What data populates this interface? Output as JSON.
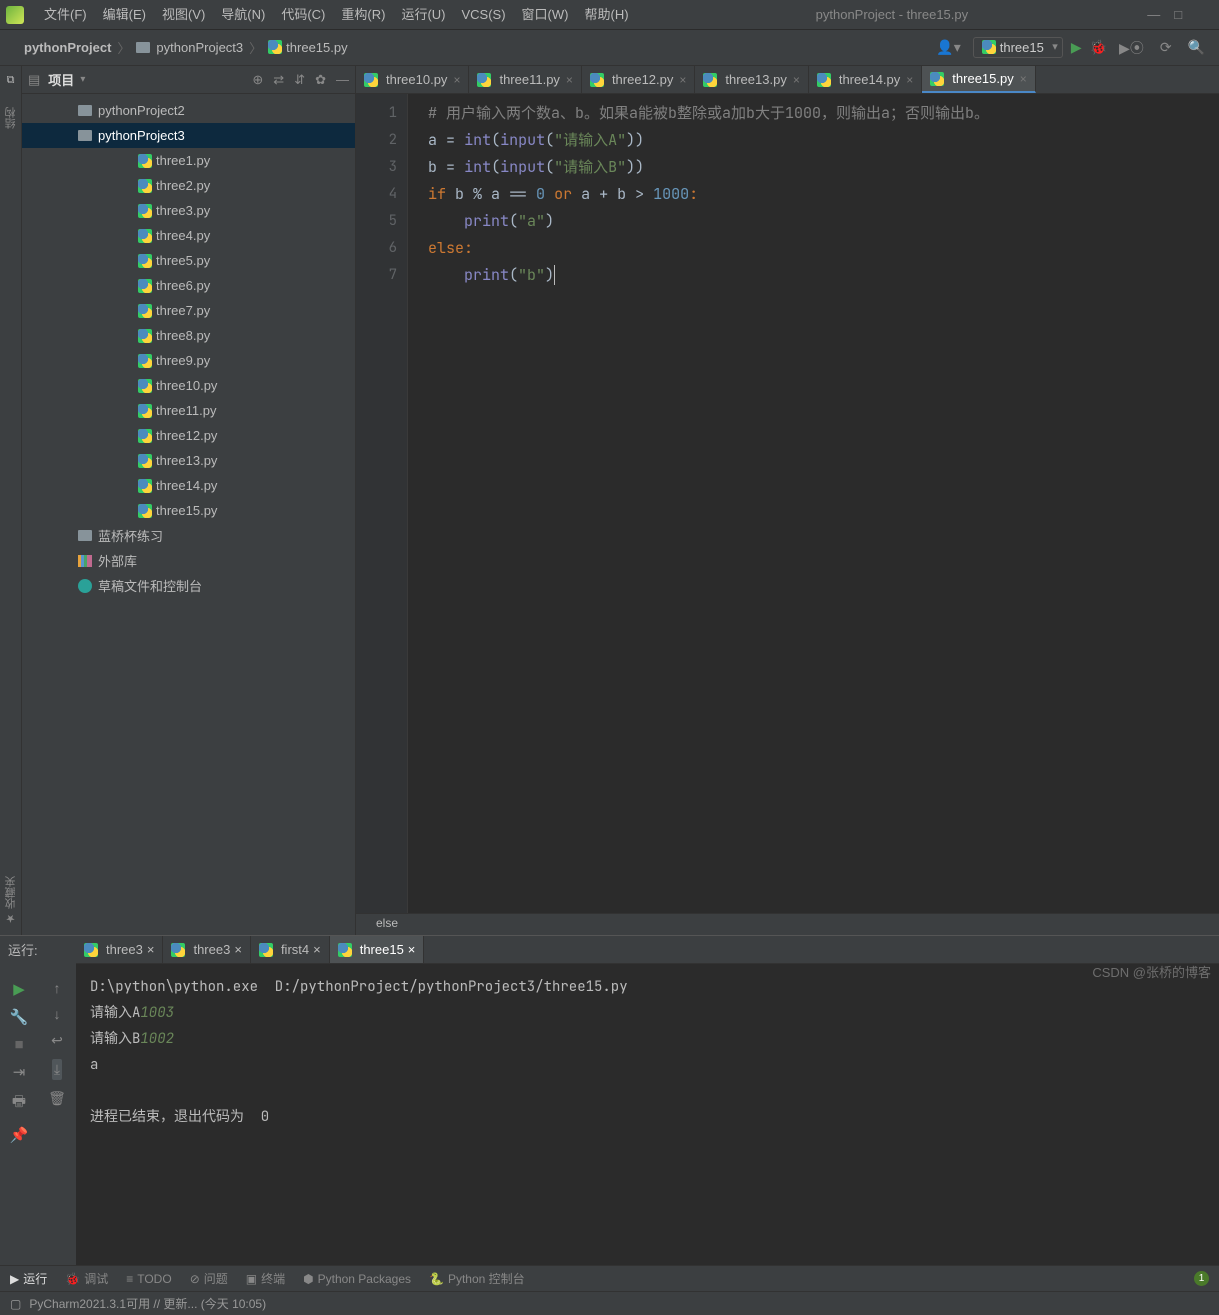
{
  "menubar": {
    "items": [
      "文件(F)",
      "编辑(E)",
      "视图(V)",
      "导航(N)",
      "代码(C)",
      "重构(R)",
      "运行(U)",
      "VCS(S)",
      "窗口(W)",
      "帮助(H)"
    ]
  },
  "window_title": "pythonProject - three15.py",
  "breadcrumbs": {
    "project": "pythonProject",
    "folder": "pythonProject3",
    "file": "three15.py"
  },
  "run_config_selected": "three15",
  "sidebar": {
    "title": "项目",
    "roots": [
      {
        "type": "folder",
        "label": "pythonProject2",
        "expanded": false,
        "indent": 0
      },
      {
        "type": "folder",
        "label": "pythonProject3",
        "expanded": true,
        "indent": 0,
        "selected": true,
        "children": [
          "three1.py",
          "three2.py",
          "three3.py",
          "three4.py",
          "three5.py",
          "three6.py",
          "three7.py",
          "three8.py",
          "three9.py",
          "three10.py",
          "three11.py",
          "three12.py",
          "three13.py",
          "three14.py",
          "three15.py"
        ]
      },
      {
        "type": "folder",
        "label": "蓝桥杯练习",
        "expanded": false,
        "indent": 0
      },
      {
        "type": "lib",
        "label": "外部库",
        "expanded": false,
        "indent": 0
      },
      {
        "type": "scratch",
        "label": "草稿文件和控制台",
        "indent": 0
      }
    ]
  },
  "left_gutter": [
    "结构",
    "收藏夹"
  ],
  "editor_tabs": [
    "three10.py",
    "three11.py",
    "three12.py",
    "three13.py",
    "three14.py",
    "three15.py"
  ],
  "editor_active_tab": "three15.py",
  "code_lines": 7,
  "code": {
    "comment": "# 用户输入两个数a、b。如果a能被b整除或a加b大于1000，则输出a；否则输出b。",
    "l2": {
      "a": "a",
      "eq": "=",
      "fn": "int",
      "fn2": "input",
      "str": "\"请输入A\""
    },
    "l3": {
      "a": "b",
      "eq": "=",
      "fn": "int",
      "fn2": "input",
      "str": "\"请输入B\""
    },
    "l4": {
      "kw": "if",
      "cond": " b % a == ",
      "zero": "0",
      "or": "or",
      "cond2": " a + b > ",
      "thou": "1000",
      "colon": ":"
    },
    "l5": {
      "fn": "print",
      "str": "\"a\""
    },
    "l6": {
      "kw": "else",
      "colon": ":"
    },
    "l7": {
      "fn": "print",
      "str": "\"b\""
    }
  },
  "crumb_trail": "else",
  "run_tabs_label": "运行:",
  "run_tabs": [
    "three3",
    "three3",
    "first4",
    "three15"
  ],
  "run_active_tab": "three15",
  "console": {
    "cmd": "D:\\python\\python.exe  D:/pythonProject/pythonProject3/three15.py",
    "p1": "请输入A",
    "i1": "1003",
    "p2": "请输入B",
    "i2": "1002",
    "out": "a",
    "exit": "进程已结束，退出代码为  0"
  },
  "bottom_tools": {
    "run": "运行",
    "debug": "调试",
    "todo": "TODO",
    "problems": "问题",
    "terminal": "终端",
    "pkg": "Python Packages",
    "console": "Python 控制台"
  },
  "statusbar": "PyCharm2021.3.1可用 // 更新... (今天 10:05)",
  "watermark": "CSDN @张桥的博客"
}
